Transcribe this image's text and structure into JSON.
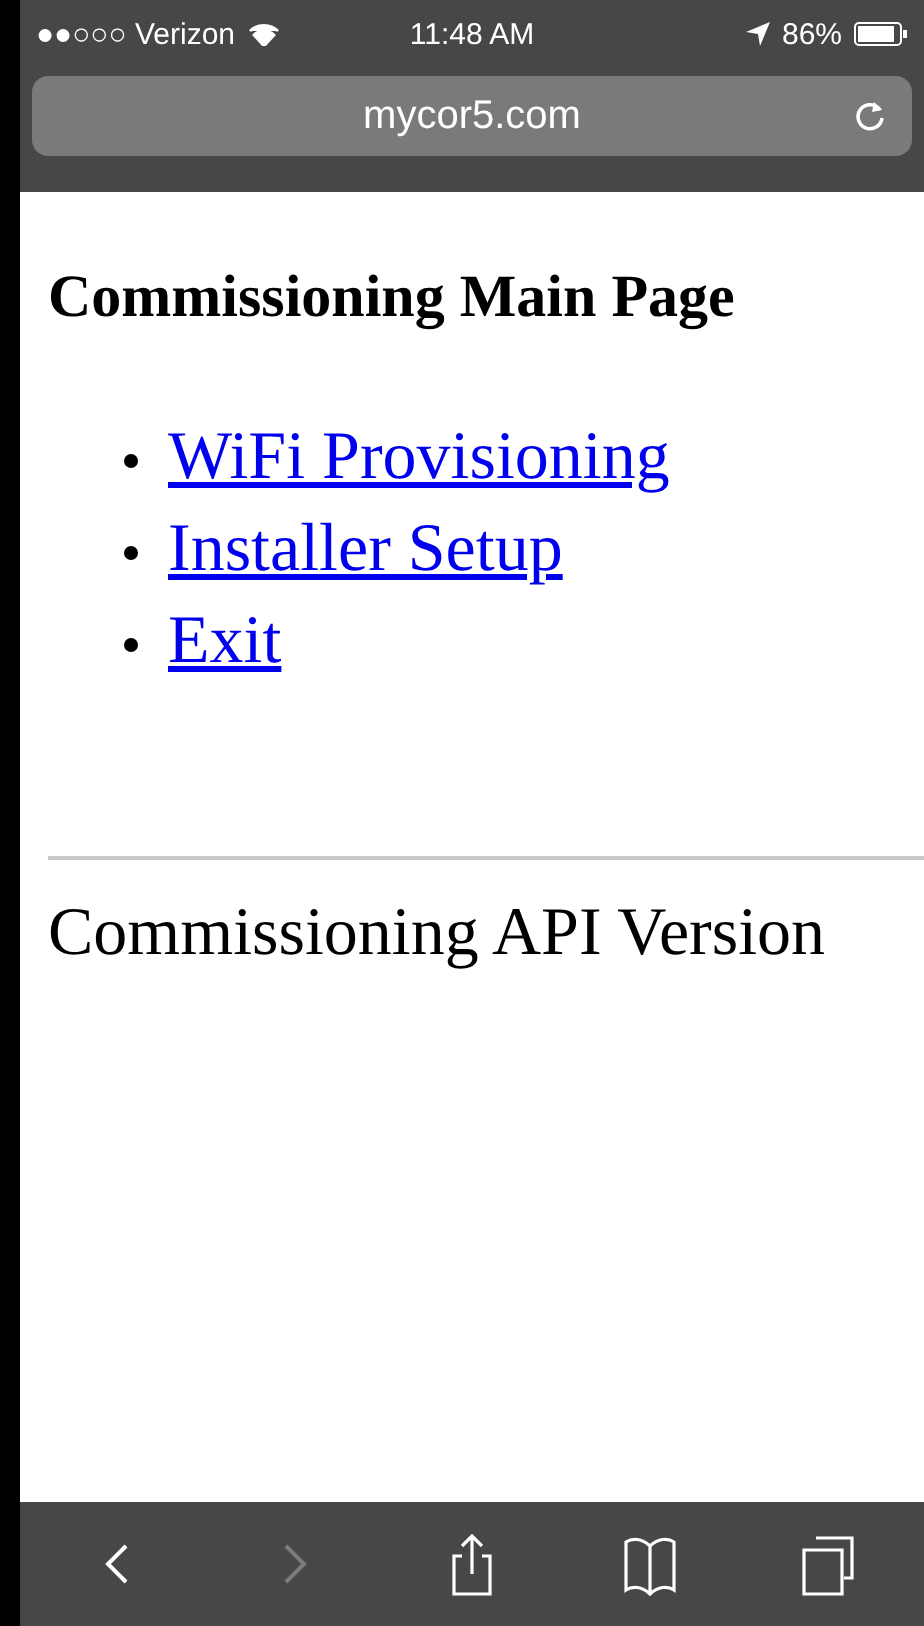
{
  "status_bar": {
    "carrier": "●●○○○ Verizon",
    "time": "11:48 AM",
    "battery": "86%"
  },
  "address_bar": {
    "url": "mycor5.com"
  },
  "page": {
    "heading": "Commissioning Main Page",
    "links": [
      {
        "label": "WiFi Provisioning"
      },
      {
        "label": "Installer Setup"
      },
      {
        "label": "Exit"
      }
    ],
    "footer_text": "Commissioning API Version"
  },
  "toolbar": [
    {
      "kind": "back",
      "disabled": false
    },
    {
      "kind": "forward",
      "disabled": true
    },
    {
      "kind": "share",
      "disabled": false
    },
    {
      "kind": "bookmarks",
      "disabled": false
    },
    {
      "kind": "tabs",
      "disabled": false
    }
  ]
}
